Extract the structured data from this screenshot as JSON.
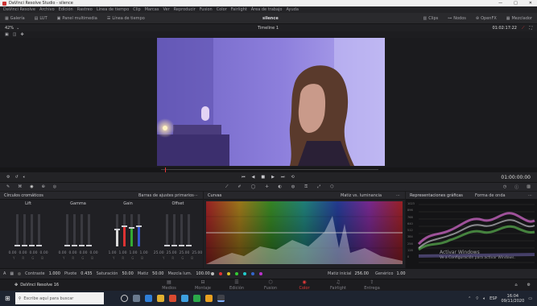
{
  "app": {
    "window_title": "DaVinci Resolve Studio - silence",
    "window_controls": [
      "—",
      "□",
      "✕"
    ]
  },
  "menu": [
    "DaVinci Resolve",
    "Archivo",
    "Edición",
    "Rastreo",
    "Línea de tiempo",
    "Clip",
    "Marcas",
    "Ver",
    "Reproducir",
    "Fusion",
    "Color",
    "Fairlight",
    "Área de trabajo",
    "Ayuda"
  ],
  "toolbar": {
    "gallery": "Galería",
    "luts": "LUT",
    "media_pool": "Panel multimedia",
    "timeline": "Línea de tiempo",
    "project_name": "silence",
    "clips": "Clips",
    "nodes": "Nodos",
    "openfx": "OpenFX",
    "lightbox": "Mezclador"
  },
  "viewer": {
    "zoom": "42%",
    "timeline_name": "Timeline 1",
    "timecode_top": "01:02:17:22",
    "timecode_transport": "01:00:00:00"
  },
  "wheels_panel": {
    "title": "Círculos cromáticos",
    "mode": "Barras de ajustes primarios",
    "wheels": [
      {
        "name": "Lift",
        "values": [
          "0.00",
          "0.00",
          "0.00",
          "0.00"
        ]
      },
      {
        "name": "Gamma",
        "values": [
          "0.00",
          "0.00",
          "0.00",
          "0.00"
        ]
      },
      {
        "name": "Gain",
        "values": [
          "1.00",
          "1.00",
          "1.00",
          "1.00"
        ]
      },
      {
        "name": "Offset",
        "values": [
          "25.00",
          "25.00",
          "25.00",
          "25.00"
        ]
      }
    ],
    "channels": [
      "Y",
      "R",
      "G",
      "B"
    ]
  },
  "curves_panel": {
    "title": "Curvas",
    "mode": "Matiz vs. luminancia",
    "input_hue_label": "Matiz inicial",
    "input_hue_value": "256.00",
    "hue_rotate_label": "Genérico",
    "hue_rotate_value": "1.00"
  },
  "scopes_panel": {
    "title": "Representaciones gráficas",
    "mode": "Forma de onda",
    "scale": [
      "1023",
      "896",
      "768",
      "640",
      "512",
      "384",
      "256",
      "128",
      "0"
    ],
    "activate_title": "Activar Windows",
    "activate_sub": "Ve a Configuración para activar Windows."
  },
  "bottom_params": {
    "contrast_label": "Contraste",
    "contrast_value": "1.000",
    "pivot_label": "Pivote",
    "pivot_value": "0.435",
    "sat_label": "Saturación",
    "sat_value": "50.00",
    "hue_label": "Matiz",
    "hue_value": "50.00",
    "lum_label": "Mezcla lum.",
    "lum_value": "100.00"
  },
  "pages": {
    "app_name": "DaVinci Resolve 16",
    "items": [
      "Medios",
      "Montaje",
      "Edición",
      "Fusion",
      "Color",
      "Fairlight",
      "Entrega"
    ],
    "active": "Color"
  },
  "taskbar": {
    "search_placeholder": "Escribe aquí para buscar",
    "time": "16:04",
    "date": "09/11/2020",
    "lang": "ESP"
  },
  "colors": {
    "accent_red": "#e63a3a",
    "panel_bg": "#202024",
    "viewer_frame": "#7a6cc9"
  }
}
